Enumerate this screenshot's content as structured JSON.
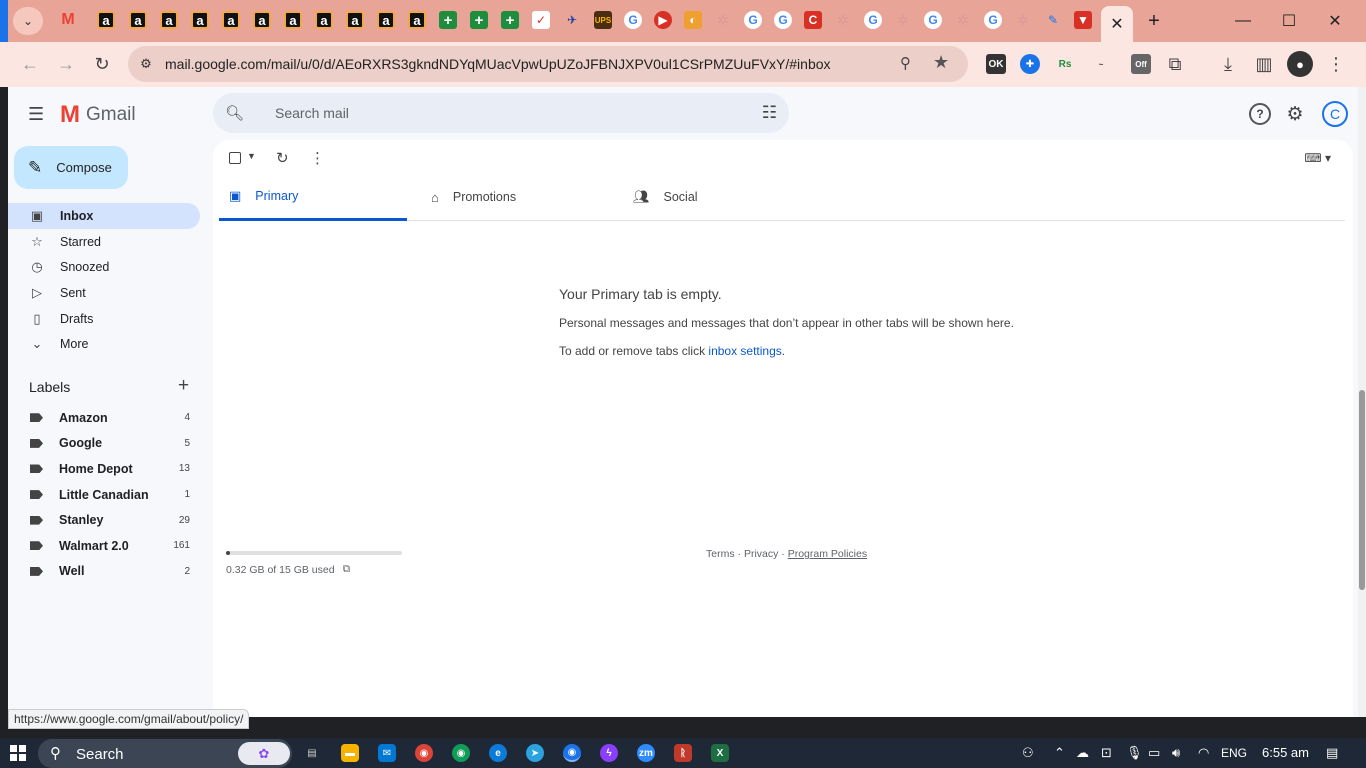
{
  "browser": {
    "url": "mail.google.com/mail/u/0/d/AEoRXRS3gkndNDYqMUacVpwUpUZoJFBNJXPV0ul1CSrPMZUuFVxY/#inbox",
    "status_url": "https://www.google.com/gmail/about/policy/",
    "tab_icons": [
      "gmail-icon",
      "amazon-icon",
      "amazon-icon",
      "amazon-icon",
      "amazon-icon",
      "amazon-icon",
      "amazon-icon",
      "amazon-icon",
      "amazon-icon",
      "amazon-icon",
      "amazon-icon",
      "plus-icon",
      "plus-icon",
      "plus-icon",
      "target-icon",
      "flag-icon",
      "ups-icon",
      "google-icon",
      "youtube-icon",
      "star-icon",
      "star-icon",
      "google-icon",
      "google-icon",
      "red-icon",
      "star-icon",
      "google-icon",
      "star-icon",
      "google-icon",
      "star-icon",
      "google-icon",
      "star-icon",
      "paint-icon",
      "vpn-icon"
    ],
    "close_glyph": "✕",
    "new_tab_glyph": "+"
  },
  "gmail": {
    "product_name": "Gmail",
    "search_placeholder": "Search mail",
    "compose_label": "Compose",
    "avatar_letter": "C",
    "nav": [
      {
        "label": "Inbox",
        "icon": "inbox-icon"
      },
      {
        "label": "Starred",
        "icon": "star-icon"
      },
      {
        "label": "Snoozed",
        "icon": "clock-icon"
      },
      {
        "label": "Sent",
        "icon": "send-icon"
      },
      {
        "label": "Drafts",
        "icon": "draft-icon"
      },
      {
        "label": "More",
        "icon": "chevron-down-icon"
      }
    ],
    "labels_title": "Labels",
    "labels": [
      {
        "name": "Amazon",
        "count": "4"
      },
      {
        "name": "Google",
        "count": "5"
      },
      {
        "name": "Home Depot",
        "count": "13"
      },
      {
        "name": "Little Canadian",
        "count": "1"
      },
      {
        "name": "Stanley",
        "count": "29"
      },
      {
        "name": "Walmart 2.0",
        "count": "161"
      },
      {
        "name": "Well",
        "count": "2"
      }
    ],
    "tabs": [
      {
        "label": "Primary",
        "icon": "inbox-icon",
        "active": true
      },
      {
        "label": "Promotions",
        "icon": "tag-icon",
        "active": false
      },
      {
        "label": "Social",
        "icon": "people-icon",
        "active": false
      }
    ],
    "empty": {
      "title": "Your Primary tab is empty.",
      "line1": "Personal messages and messages that don’t appear in other tabs will be shown here.",
      "line2_prefix": "To add or remove tabs click ",
      "line2_link": "inbox settings",
      "line2_suffix": "."
    },
    "storage": {
      "text": "0.32 GB of 15 GB used",
      "fraction": 0.021
    },
    "footer": {
      "terms": "Terms",
      "privacy": "Privacy",
      "policies": "Program Policies",
      "sep": " · "
    }
  },
  "taskbar": {
    "search_label": "Search",
    "language": "ENG",
    "time": "6:55 am"
  },
  "colors": {
    "tab_strip": "#e8a597",
    "toolbar": "#fbe6e1",
    "compose": "#c2e7ff",
    "active_nav": "#d3e3fd",
    "accent": "#0b57d0"
  }
}
